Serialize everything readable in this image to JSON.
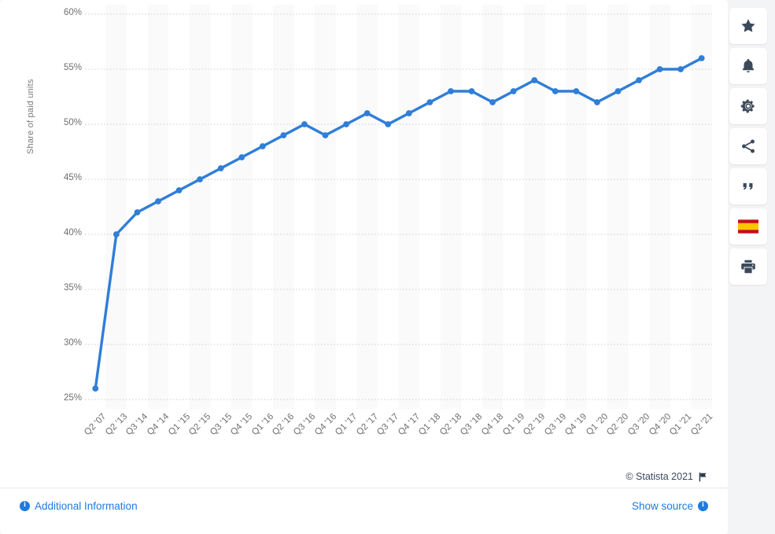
{
  "chart_data": {
    "type": "line",
    "title": "",
    "xlabel": "",
    "ylabel": "Share of paid units",
    "ylim": [
      25,
      60
    ],
    "ytick_values": [
      25,
      30,
      35,
      40,
      45,
      50,
      55,
      60
    ],
    "ytick_labels": [
      "25%",
      "30%",
      "35%",
      "40%",
      "45%",
      "50%",
      "55%",
      "60%"
    ],
    "grid": true,
    "legend": "none",
    "value_suffix": "%",
    "categories": [
      "Q2 '07",
      "Q2 '13",
      "Q3 '14",
      "Q4 '14",
      "Q1 '15",
      "Q2 '15",
      "Q3 '15",
      "Q4 '15",
      "Q1 '16",
      "Q2 '16",
      "Q3 '16",
      "Q4 '16",
      "Q1 '17",
      "Q2 '17",
      "Q3 '17",
      "Q4 '17",
      "Q1 '18",
      "Q2 '18",
      "Q3 '18",
      "Q4 '18",
      "Q1 '19",
      "Q2 '19",
      "Q3 '19",
      "Q4 '19",
      "Q1 '20",
      "Q2 '20",
      "Q3 '20",
      "Q4 '20",
      "Q1 '21",
      "Q2 '21"
    ],
    "values": [
      26,
      40,
      42,
      43,
      44,
      45,
      46,
      47,
      48,
      49,
      50,
      49,
      50,
      51,
      50,
      51,
      52,
      53,
      53,
      52,
      53,
      54,
      53,
      53,
      52,
      53,
      54,
      55,
      55,
      56
    ],
    "series": [
      {
        "name": "Share of paid units",
        "color": "#2f7ed8",
        "values": [
          26,
          40,
          42,
          43,
          44,
          45,
          46,
          47,
          48,
          49,
          50,
          49,
          50,
          51,
          50,
          51,
          52,
          53,
          53,
          52,
          53,
          54,
          53,
          53,
          52,
          53,
          54,
          55,
          55,
          56
        ]
      }
    ]
  },
  "toolbar": {
    "items": [
      {
        "name": "favorite-button",
        "icon": "star-icon",
        "label": "Favorite"
      },
      {
        "name": "notification-button",
        "icon": "bell-icon",
        "label": "Notifications"
      },
      {
        "name": "settings-button",
        "icon": "gear-icon",
        "label": "Settings"
      },
      {
        "name": "share-button",
        "icon": "share-icon",
        "label": "Share"
      },
      {
        "name": "citation-button",
        "icon": "quote-icon",
        "label": "Cite"
      },
      {
        "name": "language-button",
        "icon": "spain-flag-icon",
        "label": "Español"
      },
      {
        "name": "print-button",
        "icon": "printer-icon",
        "label": "Print"
      }
    ]
  },
  "footer": {
    "copyright": "© Statista 2021",
    "flag_icon": "flag-icon",
    "additional_information": "Additional Information",
    "show_source": "Show source",
    "info_glyph": "i"
  },
  "colors": {
    "line": "#2f7ed8",
    "link": "#1f7ae0",
    "grid": "#cfcfcf",
    "band": "#fafafa",
    "page_bg": "#f3f4f6",
    "card_bg": "#ffffff",
    "tick_text": "#6f6f6f",
    "toolbar_icon": "#3b4a5a"
  }
}
